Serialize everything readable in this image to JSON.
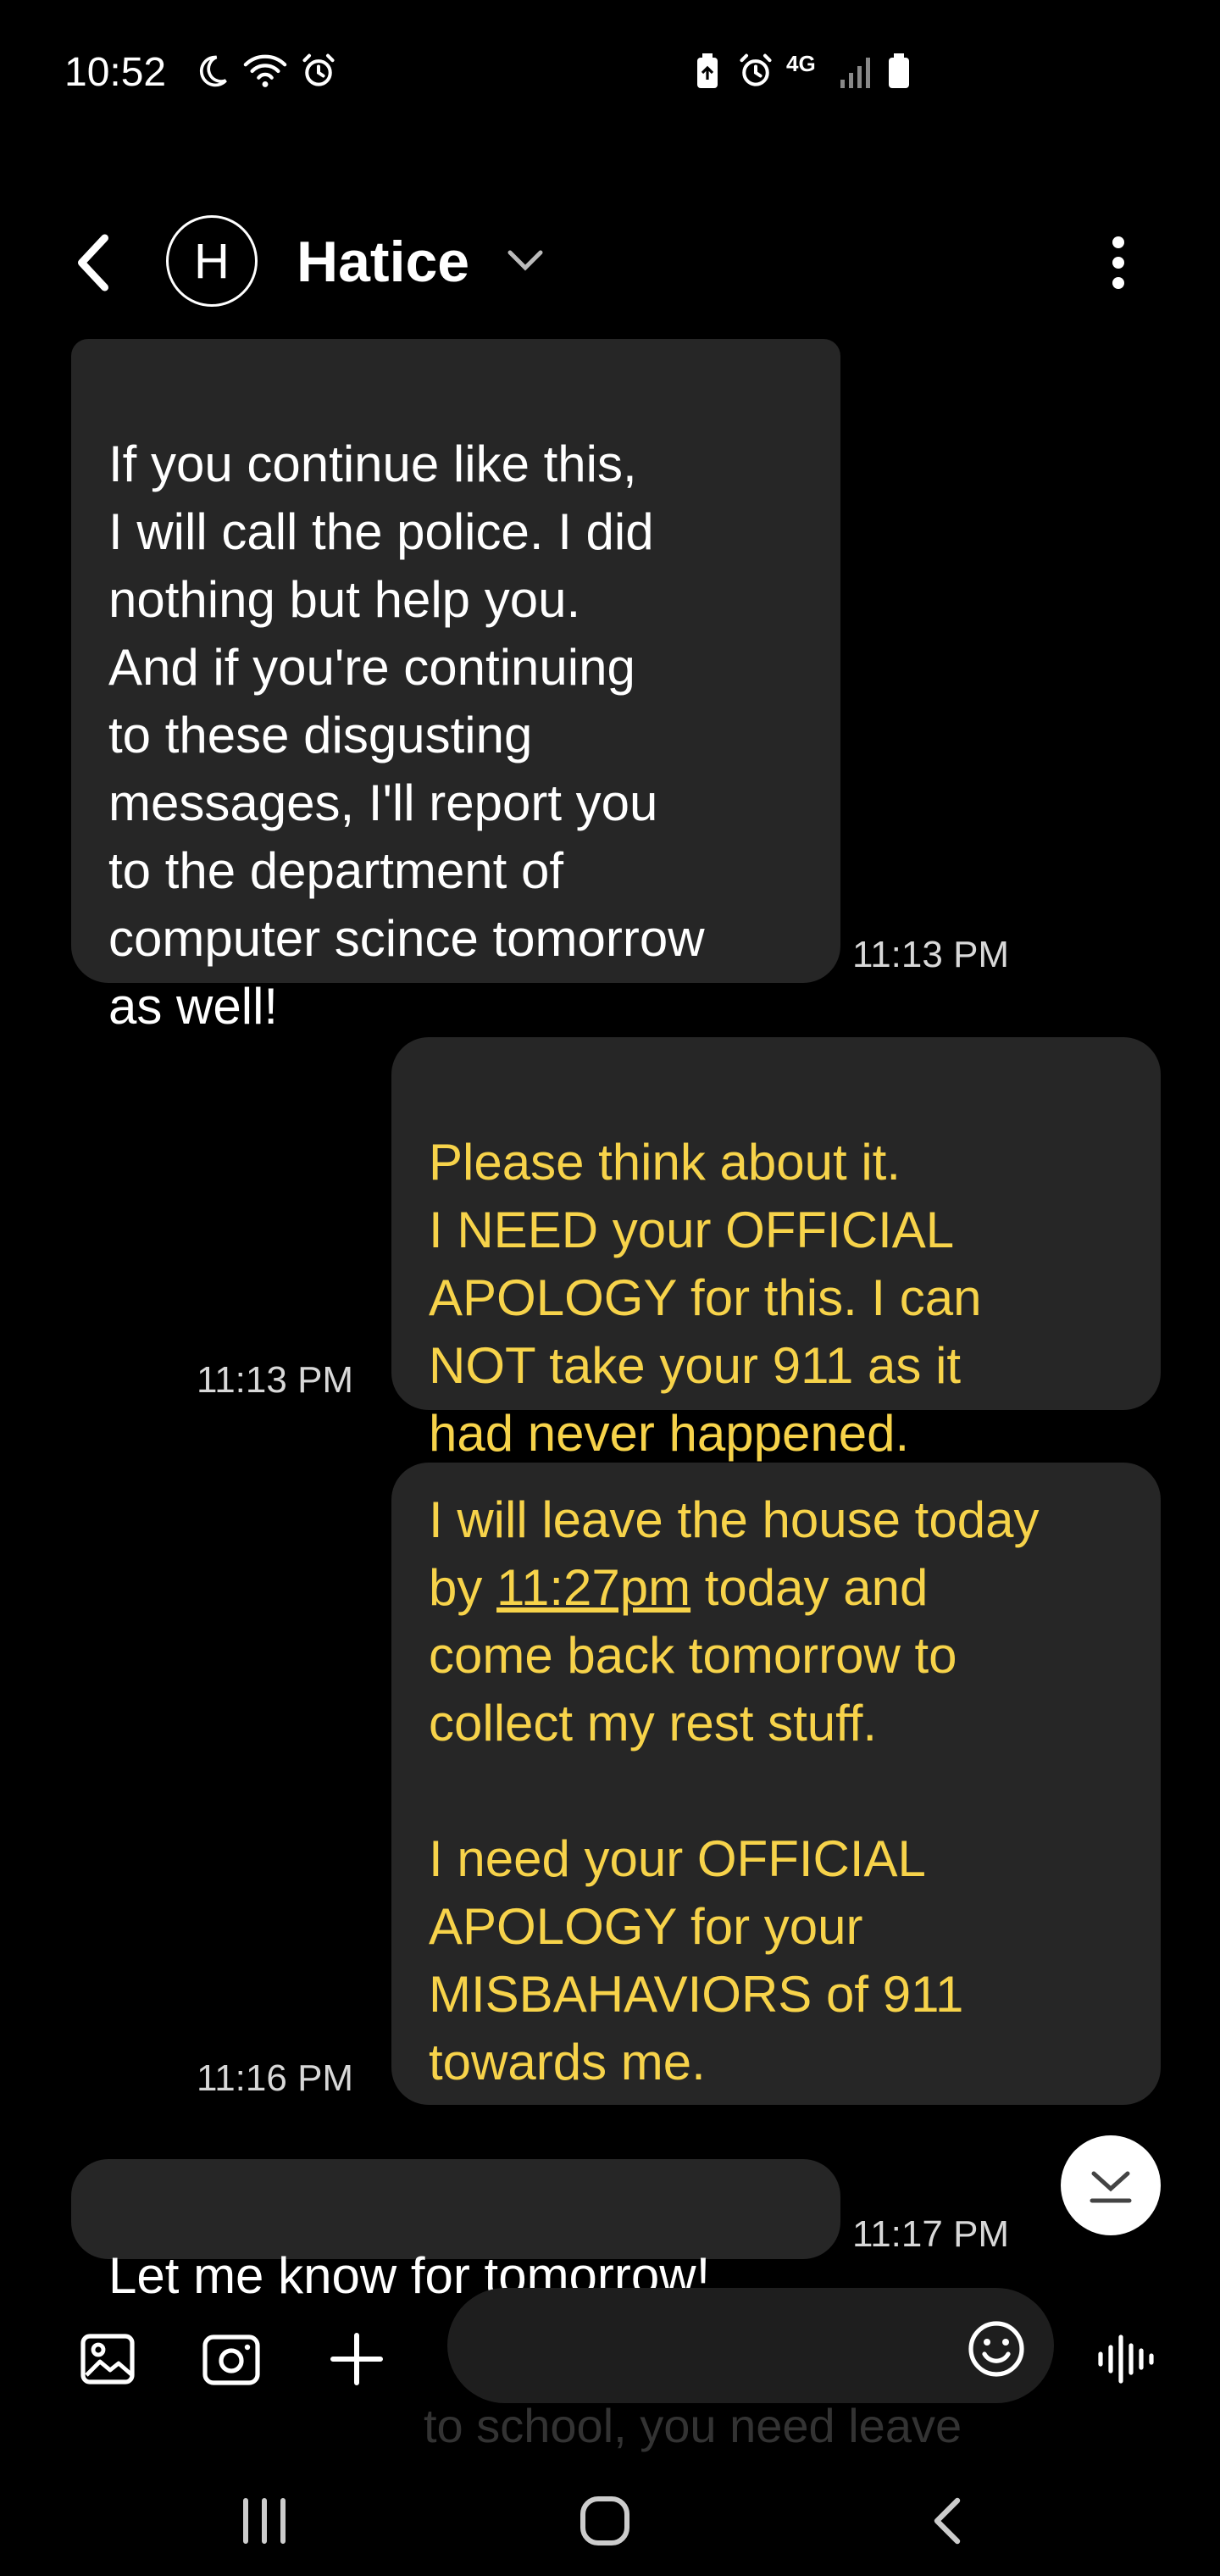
{
  "status_bar": {
    "time": "10:52",
    "network": "4G"
  },
  "header": {
    "avatar_letter": "H",
    "contact_name": "Hatice"
  },
  "messages": [
    {
      "direction": "incoming",
      "text": "If you continue like this,\nI will call the police. I did\nnothing but help you.\nAnd if you're continuing\nto these disgusting\nmessages, I'll report you\nto the department of\ncomputer scince tomorrow\nas well!",
      "time": "11:13 PM"
    },
    {
      "direction": "outgoing",
      "text": "Please think about it.\nI NEED your OFFICIAL\nAPOLOGY for this. I can\nNOT take your 911 as it\nhad never happened.",
      "time": "11:13 PM"
    },
    {
      "direction": "outgoing",
      "text_before": "I will leave the house today\nby ",
      "link": "11:27pm",
      "text_after": " today and\ncome back tomorrow to\ncollect my rest stuff.\n\nI need your OFFICIAL\nAPOLOGY for your\nMISBAHAVIORS of 911\ntowards me.",
      "time": "11:16 PM"
    },
    {
      "direction": "incoming",
      "text": "Let me know for tomorrow!",
      "time": "11:17 PM"
    }
  ],
  "composer": {
    "ghost_text": "to school, you need leave"
  },
  "colors": {
    "background": "#000000",
    "bubble": "#262626",
    "outgoing_text": "#f7d34a",
    "incoming_text": "#ffffff"
  }
}
